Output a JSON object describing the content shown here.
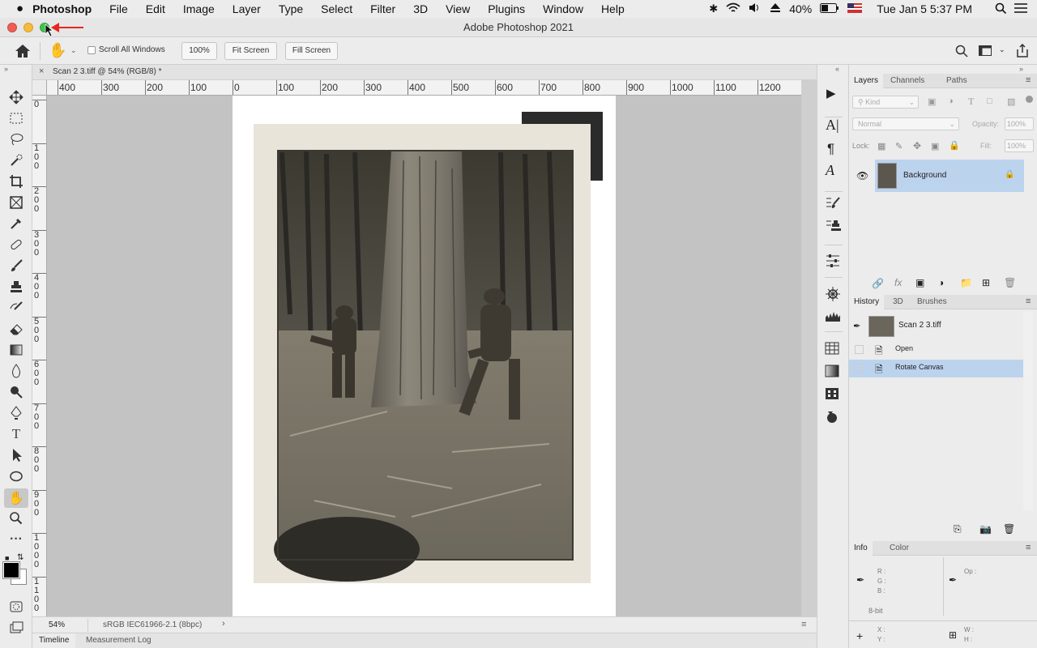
{
  "menubar": {
    "apple": "",
    "app": "Photoshop",
    "items": [
      "File",
      "Edit",
      "Image",
      "Layer",
      "Type",
      "Select",
      "Filter",
      "3D",
      "View",
      "Plugins",
      "Window",
      "Help"
    ],
    "battery": "40%",
    "datetime": "Tue Jan 5  5:37 PM"
  },
  "window": {
    "title": "Adobe Photoshop 2021"
  },
  "options": {
    "scroll_all": "Scroll All Windows",
    "zoom": "100%",
    "fit": "Fit Screen",
    "fill": "Fill Screen"
  },
  "document": {
    "tab": "Scan 2 3.tiff @ 54% (RGB/8) *",
    "zoom": "54%",
    "profile": "sRGB IEC61966-2.1 (8bpc)"
  },
  "rulers": {
    "h": [
      "400",
      "300",
      "200",
      "100",
      "0",
      "100",
      "200",
      "300",
      "400",
      "500",
      "600",
      "700",
      "800",
      "900",
      "1000",
      "1100",
      "1200"
    ],
    "v": [
      "0",
      "1\n0\n0",
      "2\n0\n0",
      "3\n0\n0",
      "4\n0\n0",
      "5\n0\n0",
      "6\n0\n0",
      "7\n0\n0",
      "8\n0\n0",
      "9\n0\n0",
      "1\n0\n0\n0",
      "1\n1\n0\n0"
    ]
  },
  "bottom_tabs": [
    "Timeline",
    "Measurement Log"
  ],
  "layers_panel": {
    "tabs": [
      "Layers",
      "Channels",
      "Paths"
    ],
    "kind": "Kind",
    "blend": "Normal",
    "opacity_label": "Opacity:",
    "opacity": "100%",
    "lock_label": "Lock:",
    "fill_label": "Fill:",
    "fill": "100%",
    "layer_name": "Background"
  },
  "history_panel": {
    "tabs": [
      "History",
      "3D",
      "Brushes"
    ],
    "snapshot": "Scan 2 3.tiff",
    "states": [
      "Open",
      "Rotate Canvas"
    ]
  },
  "info_panel": {
    "tabs": [
      "Info",
      "Color"
    ],
    "r": "R :",
    "g": "G :",
    "b": "B :",
    "op": "Op :",
    "bit": "8-bit",
    "x": "X :",
    "y": "Y :",
    "w": "W :",
    "h": "H :"
  },
  "colors": {
    "selection": "#bcd3ee",
    "canvas_bg": "#c3c3c3",
    "annotation": "#e8271e"
  }
}
